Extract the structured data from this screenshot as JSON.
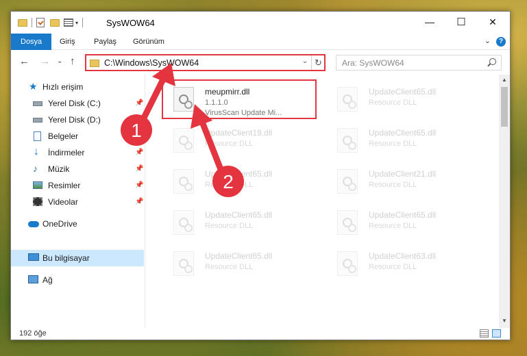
{
  "window": {
    "title": "SysWOW64",
    "controls": {
      "minimize": "—",
      "maximize": "☐",
      "close": "✕"
    }
  },
  "ribbon": {
    "tabs": [
      "Dosya",
      "Giriş",
      "Paylaş",
      "Görünüm"
    ],
    "help": "?"
  },
  "navigation": {
    "back": "←",
    "forward": "→",
    "recent": "⌄",
    "up": "↑"
  },
  "address": {
    "path": "C:\\Windows\\SysWOW64",
    "refresh": "↻"
  },
  "search": {
    "placeholder": "Ara: SysWOW64"
  },
  "sidebar": {
    "items": [
      {
        "label": "Hızlı erişim",
        "icon": "star-icon",
        "pinned": false
      },
      {
        "label": "Yerel Disk (C:)",
        "icon": "drive-icon",
        "pinned": true
      },
      {
        "label": "Yerel Disk (D:)",
        "icon": "drive-icon",
        "pinned": false
      },
      {
        "label": "Belgeler",
        "icon": "documents-icon",
        "pinned": true
      },
      {
        "label": "İndirmeler",
        "icon": "downloads-icon",
        "pinned": true
      },
      {
        "label": "Müzik",
        "icon": "music-icon",
        "pinned": true
      },
      {
        "label": "Resimler",
        "icon": "pictures-icon",
        "pinned": true
      },
      {
        "label": "Videolar",
        "icon": "videos-icon",
        "pinned": true
      },
      {
        "label": "OneDrive",
        "icon": "onedrive-icon",
        "pinned": false
      },
      {
        "label": "Bu bilgisayar",
        "icon": "computer-icon",
        "pinned": false,
        "selected": true
      },
      {
        "label": "Ağ",
        "icon": "network-icon",
        "pinned": false
      }
    ],
    "pin_glyph": "📌"
  },
  "files": [
    {
      "name": "meupmirr.dll",
      "line2": "1.1.1.0",
      "line3": "VirusScan Update Mi...",
      "highlighted": true
    },
    {
      "name": "UpdateClient65.dll",
      "line2": "Resource DLL"
    },
    {
      "name": "UpdateClient19.dll",
      "line2": "Resource DLL"
    },
    {
      "name": "UpdateClient65.dll",
      "line2": "Resource DLL"
    },
    {
      "name": "UpdateClient65.dll",
      "line2": "Resource DLL"
    },
    {
      "name": "UpdateClient21.dll",
      "line2": "Resource DLL"
    },
    {
      "name": "UpdateClient65.dll",
      "line2": "Resource DLL"
    },
    {
      "name": "UpdateClient65.dll",
      "line2": "Resource DLL"
    },
    {
      "name": "UpdateClient65.dll",
      "line2": "Resource DLL"
    },
    {
      "name": "UpdateClient63.dll",
      "line2": "Resource DLL"
    }
  ],
  "status": {
    "count": "192 öğe"
  },
  "annotations": {
    "step1": "1",
    "step2": "2",
    "color": "#e3343f"
  }
}
